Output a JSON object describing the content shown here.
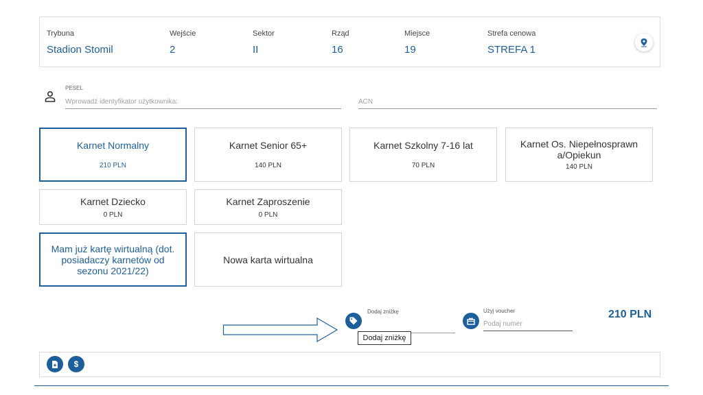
{
  "seat": {
    "columns": [
      {
        "label": "Trybuna",
        "value": "Stadion Stomil"
      },
      {
        "label": "Wejście",
        "value": "2"
      },
      {
        "label": "Sektor",
        "value": "II"
      },
      {
        "label": "Rząd",
        "value": "16"
      },
      {
        "label": "Miejsce",
        "value": "19"
      },
      {
        "label": "Strefa cenowa",
        "value": "STREFA 1"
      }
    ],
    "location_icon": "map-pin-icon"
  },
  "identity": {
    "user_icon": "user-icon",
    "pesel_label": "PESEL",
    "pesel_placeholder": "Wprowadź identyfikator użytkownika:",
    "acn_placeholder": "ACN"
  },
  "tickets": [
    {
      "name": "Karnet Normalny",
      "price": "210 PLN",
      "selected": true
    },
    {
      "name": "Karnet Senior 65+",
      "price": "140 PLN",
      "selected": false
    },
    {
      "name": "Karnet Szkolny 7-16 lat",
      "price": "70 PLN",
      "selected": false
    },
    {
      "name": "Karnet Os. Niepełnosprawna/Opiekun",
      "price": "140 PLN",
      "selected": false
    },
    {
      "name": "Karnet Dziecko",
      "price": "0 PLN",
      "selected": false
    },
    {
      "name": "Karnet Zaproszenie",
      "price": "0 PLN",
      "selected": false
    }
  ],
  "virtual_card": {
    "existing": "Mam już kartę wirtualną (dot. posiadaczy karnetów od sezonu 2021/22)",
    "new": "Nowa karta wirtualna"
  },
  "discount": {
    "label": "Dodaj zniżkę",
    "tooltip": "Dodaj zniżkę",
    "icon": "tag-icon"
  },
  "voucher": {
    "label": "Użyj voucher",
    "placeholder": "Podaj numer",
    "icon": "voucher-icon"
  },
  "total": "210 PLN",
  "bottom_actions": [
    {
      "icon": "document-icon"
    },
    {
      "icon": "dollar-icon",
      "glyph": "$"
    }
  ],
  "colors": {
    "accent": "#1d5f9a",
    "border": "#d4d4d4"
  }
}
